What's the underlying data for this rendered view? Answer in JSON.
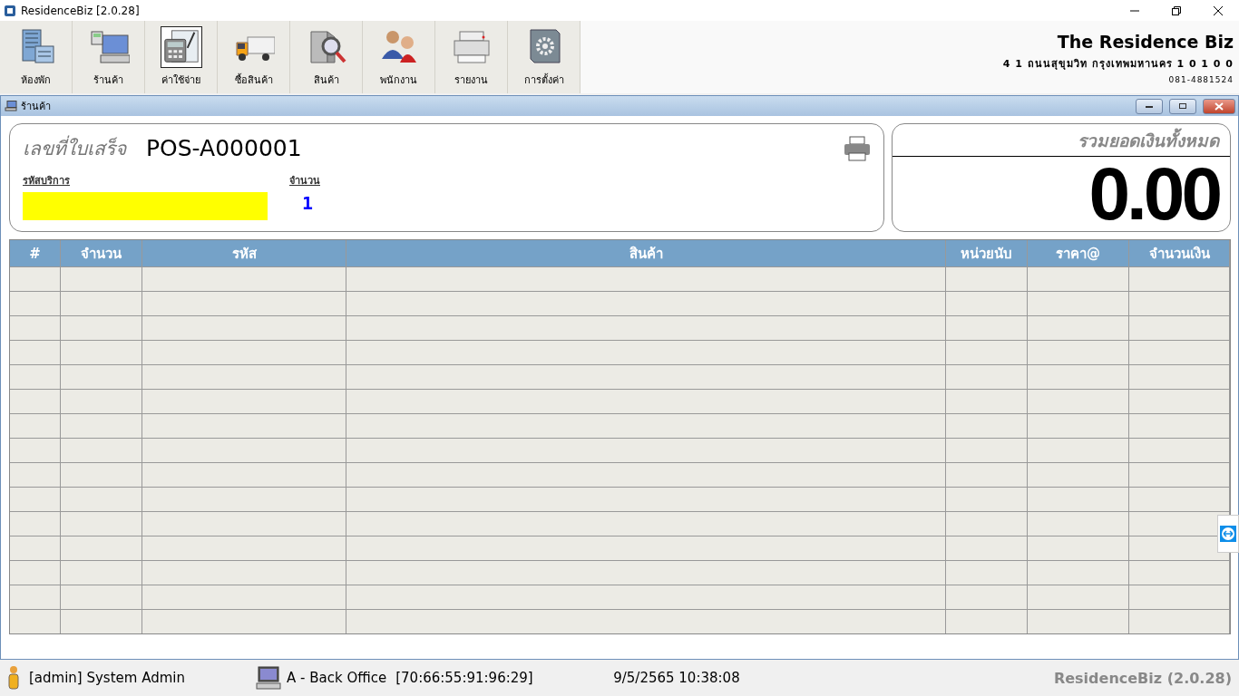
{
  "window": {
    "title": "ResidenceBiz [2.0.28]"
  },
  "toolbar": [
    {
      "label": "ห้องพัก",
      "kind": "building",
      "selected": false
    },
    {
      "label": "ร้านค้า",
      "kind": "computer",
      "selected": false
    },
    {
      "label": "ค่าใช้จ่าย",
      "kind": "calculator",
      "selected": true
    },
    {
      "label": "ซื้อสินค้า",
      "kind": "truck",
      "selected": false
    },
    {
      "label": "สินค้า",
      "kind": "magnifier",
      "selected": false
    },
    {
      "label": "พนักงาน",
      "kind": "people",
      "selected": false
    },
    {
      "label": "รายงาน",
      "kind": "printer",
      "selected": false
    },
    {
      "label": "การตั้งค่า",
      "kind": "gear",
      "selected": false
    }
  ],
  "company": {
    "name": "The Residence Biz",
    "address": "4 1  ถนนสุขุมวิท  กรุงเทพมหานคร  1 0 1 0 0",
    "phone": "081-4881524"
  },
  "child_window": {
    "title": "ร้านค้า"
  },
  "receipt": {
    "label": "เลขที่ใบเสร็จ",
    "number": "POS-A000001",
    "service_code_label": "รหัสบริการ",
    "quantity_label": "จำนวน",
    "quantity": "1"
  },
  "total": {
    "label": "รวมยอดเงินทั้งหมด",
    "amount": "0.00"
  },
  "table": {
    "columns": [
      "#",
      "จำนวน",
      "รหัส",
      "สินค้า",
      "หน่วยนับ",
      "ราคา@",
      "จำนวนเงิน"
    ]
  },
  "status_bar": {
    "user": "[admin] System Admin",
    "terminal": "A - Back Office",
    "mac": "[70:66:55:91:96:29]",
    "datetime": "9/5/2565 10:38:08",
    "app": "ResidenceBiz (2.0.28)"
  }
}
